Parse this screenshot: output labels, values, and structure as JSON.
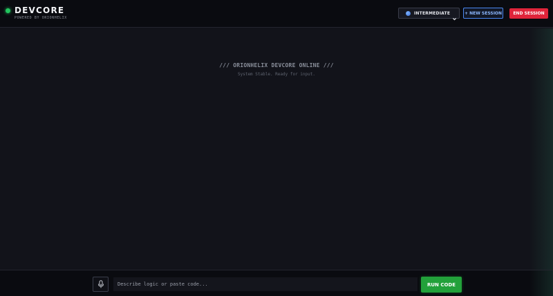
{
  "header": {
    "brand_title": "DEVCORE",
    "brand_subtitle": "POWERED BY ORIONHELIX",
    "level_select": {
      "selected": "INTERMEDIATE",
      "icon": "globe-icon"
    },
    "new_session_label": "+ NEW SESSION",
    "end_session_label": "END SESSION"
  },
  "main": {
    "status_title": "/// ORIONHELIX DEVCORE ONLINE ///",
    "status_subtitle": "System Stable. Ready for input."
  },
  "footer": {
    "mic_icon": "microphone-icon",
    "input_placeholder": "Describe logic or paste code...",
    "input_value": "",
    "run_label": "RUN CODE"
  },
  "colors": {
    "background": "#12131a",
    "header_bg": "#0a0b10",
    "accent_green": "#22a13a",
    "accent_blue": "#4a88f2",
    "danger_red": "#e0243a"
  }
}
